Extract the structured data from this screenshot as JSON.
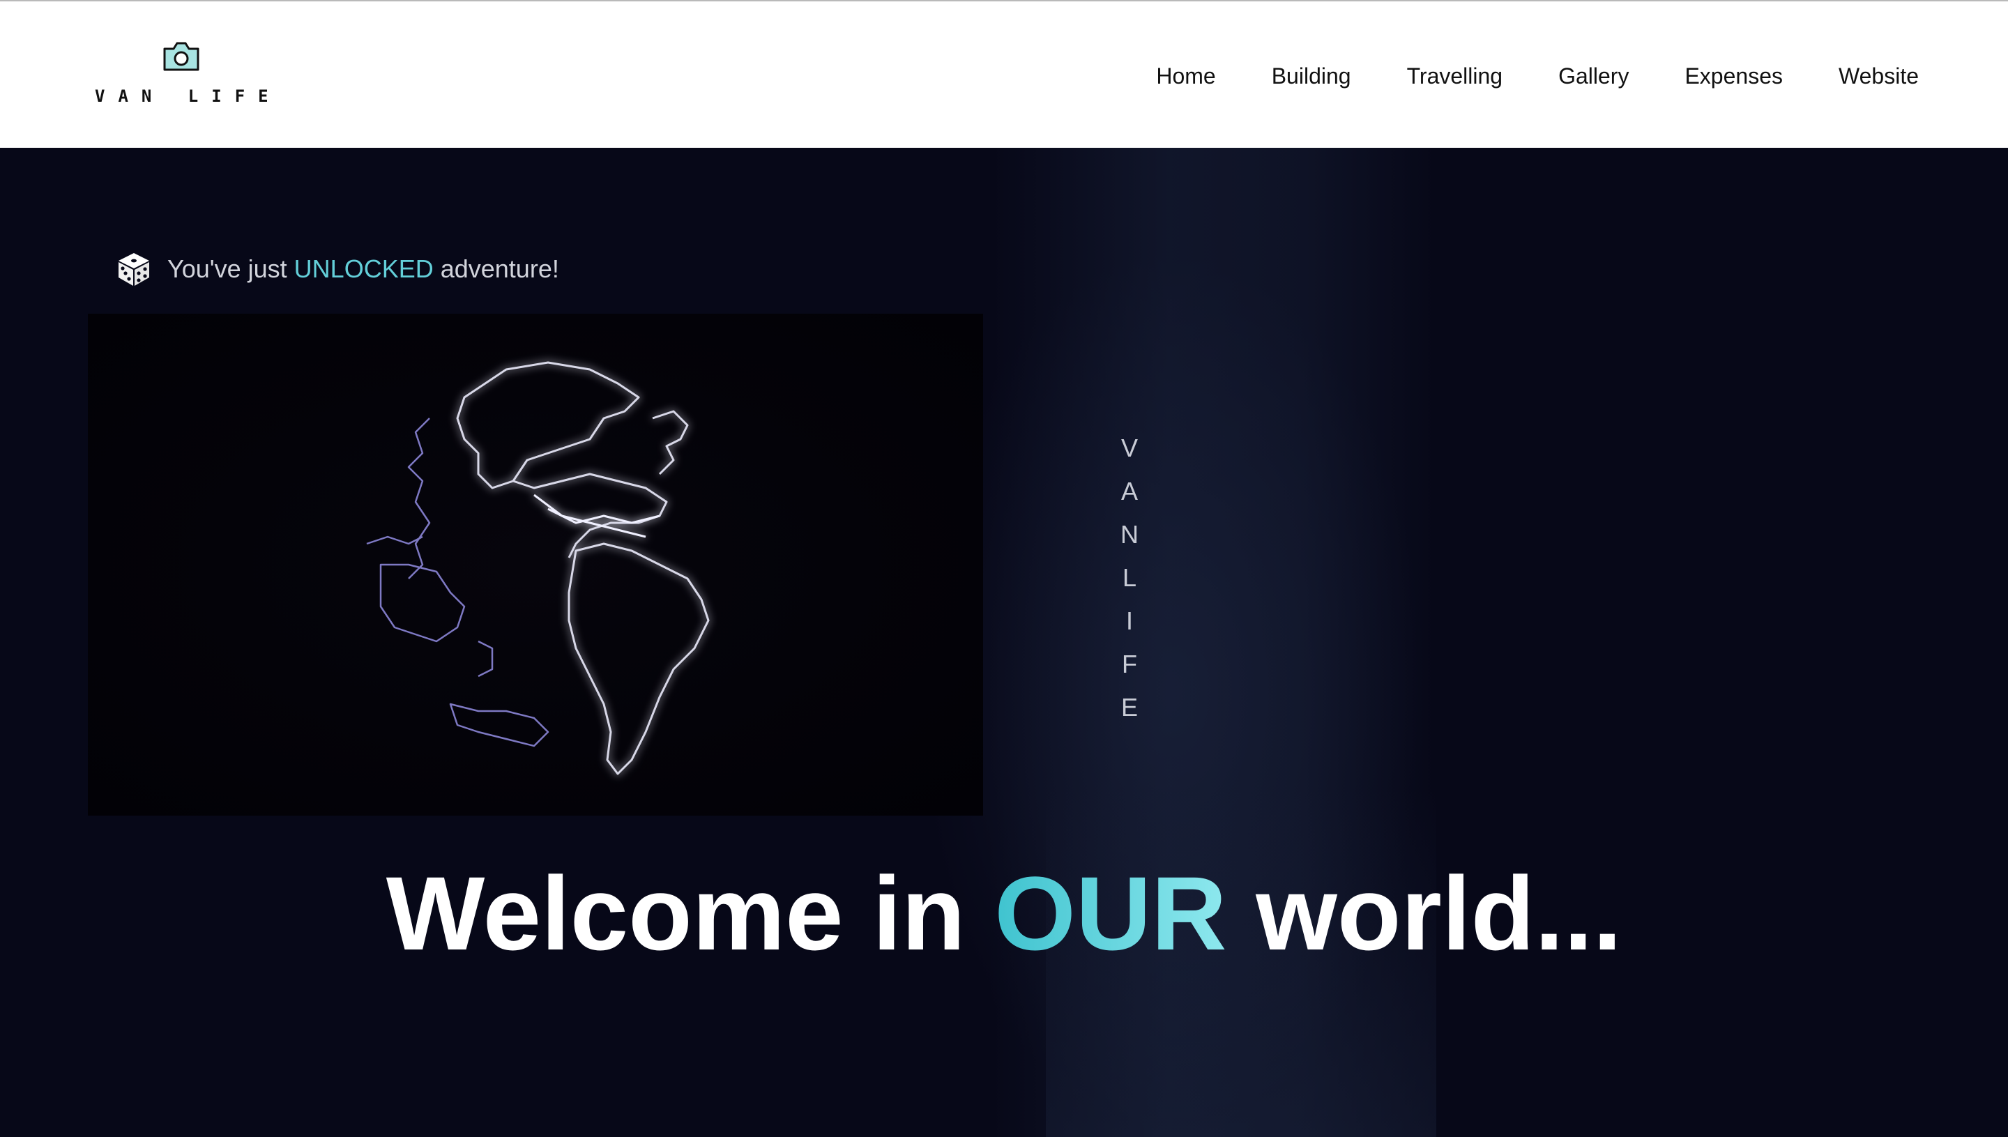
{
  "header": {
    "logo_text": "VAN LIFE",
    "logo_icon": "camera-icon",
    "nav": [
      "Home",
      "Building",
      "Travelling",
      "Gallery",
      "Expenses",
      "Website"
    ]
  },
  "hero": {
    "unlock_icon": "dice-icon",
    "unlock_prefix": "You've just ",
    "unlock_highlight": "UNLOCKED",
    "unlock_suffix": " adventure!",
    "globe_media": "animated-globe-video",
    "vertical_letters": [
      "V",
      "A",
      "N",
      "L",
      "I",
      "F",
      "E"
    ],
    "welcome_prefix": "Welcome in ",
    "welcome_highlight": "OUR",
    "welcome_suffix": " world..."
  },
  "colors": {
    "accent": "#63cfd9",
    "background": "#070818",
    "header_bg": "#ffffff"
  }
}
